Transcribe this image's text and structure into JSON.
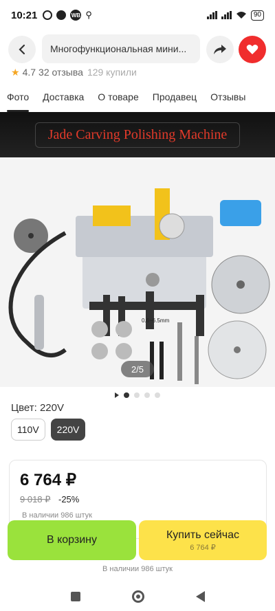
{
  "status": {
    "time": "10:21",
    "wb_badge": "WB",
    "battery": "90"
  },
  "header": {
    "search_text": "Многофункциональная мини..."
  },
  "rating": {
    "score": "4.7",
    "reviews": "32 отзыва",
    "bought": "129 купили"
  },
  "tabs": [
    "Фото",
    "Доставка",
    "О товаре",
    "Продавец",
    "Отзывы"
  ],
  "gallery": {
    "banner_text": "Jade Carving Polishing Machine",
    "counter": "2/5",
    "spec_label": "0.6~6.5mm",
    "dots_total": 4,
    "dot_active": 0
  },
  "color": {
    "label": "Цвет: 220V",
    "options": [
      "110V",
      "220V"
    ],
    "selected": "220V"
  },
  "price": {
    "current": "6 764 ₽",
    "old": "9 018 ₽",
    "discount": "-25%",
    "stock": "В наличии 986 штук"
  },
  "actions": {
    "cart_label": "В корзину",
    "buy_label": "Купить сейчас",
    "buy_price": "6 764 ₽",
    "stock": "В наличии 986 штук"
  },
  "colors": {
    "cart": "#9ae23c",
    "buy": "#fde24a",
    "fav": "#f02d2d",
    "banner_text": "#e23a2a"
  }
}
